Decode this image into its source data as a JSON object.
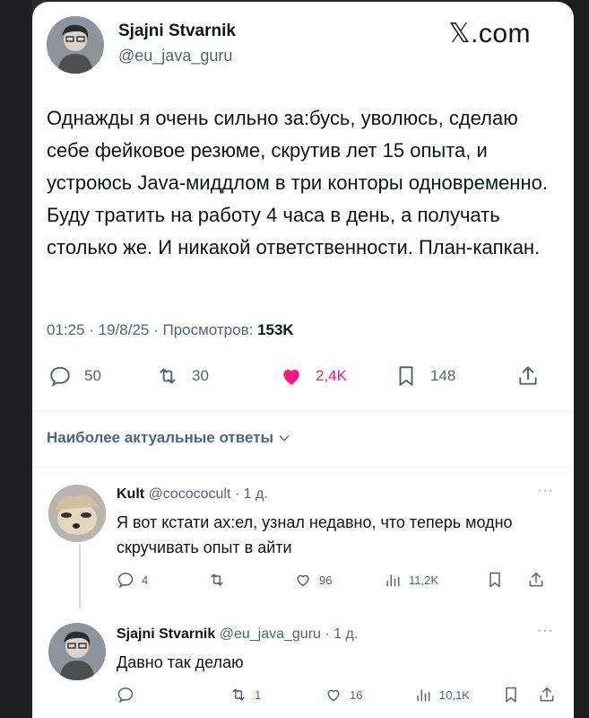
{
  "header": {
    "author_name": "Sjajni Stvarnik",
    "author_handle": "@eu_java_guru",
    "site_label": "𝕏.com"
  },
  "tweet": {
    "text": "Однажды я очень сильно за:бусь, уволюсь, сделаю себе фейковое резюме, скрутив лет 15 опыта, и устроюсь Java-миддлом в три конторы одновременно. Буду тратить на работу 4 часа в день, а получать столько же. И никакой ответственности. План-капкан.",
    "time": "01:25 · 19/8/25 · Просмотров:",
    "views": "153K"
  },
  "actions": {
    "replies": "50",
    "reposts": "30",
    "likes": "2,4K",
    "bookmarks": "148"
  },
  "replies_section": {
    "label": "Наиболее актуальные ответы"
  },
  "replies": [
    {
      "name": "Kult",
      "handle_time": "@cococoсult · 1 д.",
      "text": "Я вот кстати ах:ел, узнал недавно, что теперь модно скручивать опыт в айти",
      "replies": "4",
      "reposts": "",
      "likes": "96",
      "views": "11,2K"
    },
    {
      "name": "Sjajni Stvarnik",
      "handle_time": "@eu_java_guru · 1 д.",
      "text": "Давно так делаю",
      "replies": "",
      "reposts": "1",
      "likes": "16",
      "views": "10,1K"
    }
  ],
  "icons": {
    "reply": "reply-icon",
    "repost": "repost-icon",
    "like": "heart-icon",
    "bookmark": "bookmark-icon",
    "share": "share-icon",
    "views": "views-icon",
    "more": "more-icon"
  },
  "colors": {
    "like": "#f91880",
    "secondary_text": "#536471",
    "primary_text": "#0f1419"
  }
}
